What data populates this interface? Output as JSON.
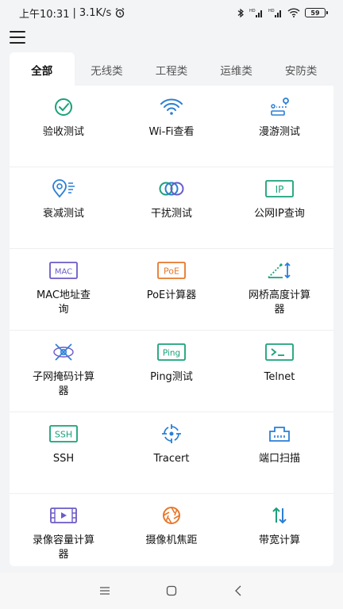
{
  "status_bar": {
    "time": "上午10:31",
    "speed": "3.1K/s",
    "battery": "59"
  },
  "tabs": [
    {
      "label": "全部"
    },
    {
      "label": "无线类"
    },
    {
      "label": "工程类"
    },
    {
      "label": "运维类"
    },
    {
      "label": "安防类"
    }
  ],
  "tools": [
    {
      "label": "验收测试",
      "icon": "check-circle-icon"
    },
    {
      "label": "Wi-Fi查看",
      "icon": "wifi-icon"
    },
    {
      "label": "漫游测试",
      "icon": "roaming-icon"
    },
    {
      "label": "衰减测试",
      "icon": "attenuation-icon"
    },
    {
      "label": "干扰测试",
      "icon": "interference-icon"
    },
    {
      "label": "公网IP查询",
      "icon": "ip-icon",
      "icon_text": "IP"
    },
    {
      "label": "MAC地址查询",
      "icon": "mac-icon",
      "icon_text": "MAC"
    },
    {
      "label": "PoE计算器",
      "icon": "poe-icon",
      "icon_text": "PoE"
    },
    {
      "label": "网桥高度计算器",
      "icon": "bridge-height-icon"
    },
    {
      "label": "子网掩码计算器",
      "icon": "subnet-icon"
    },
    {
      "label": "Ping测试",
      "icon": "ping-icon",
      "icon_text": "Ping"
    },
    {
      "label": "Telnet",
      "icon": "terminal-icon",
      "icon_text": ">_"
    },
    {
      "label": "SSH",
      "icon": "ssh-icon",
      "icon_text": "SSH"
    },
    {
      "label": "Tracert",
      "icon": "crosshair-icon"
    },
    {
      "label": "端口扫描",
      "icon": "port-icon"
    },
    {
      "label": "录像容量计算器",
      "icon": "video-icon"
    },
    {
      "label": "摄像机焦距",
      "icon": "aperture-icon"
    },
    {
      "label": "带宽计算",
      "icon": "bandwidth-icon"
    }
  ],
  "colors": {
    "green": "#1aa179",
    "blue": "#2b7fd6",
    "purple": "#6a5bc8",
    "orange": "#e8772a"
  }
}
